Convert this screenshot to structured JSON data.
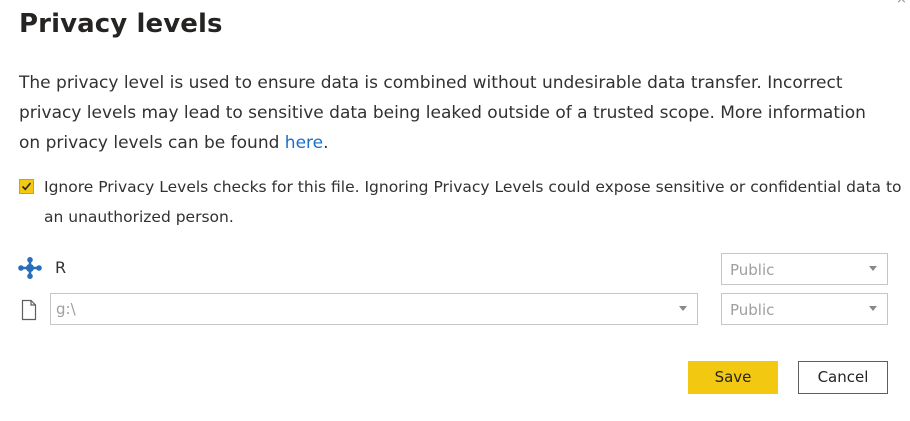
{
  "dialog": {
    "title": "Privacy levels",
    "description": "The privacy level is used to ensure data is combined without undesirable data transfer. Incorrect privacy levels may lead to sensitive data being leaked outside of a trusted scope. More information on privacy levels can be found ",
    "description_link": "here",
    "description_end": ".",
    "ignore_checkbox": {
      "checked": true,
      "label": "Ignore Privacy Levels checks for this file. Ignoring Privacy Levels could expose sensitive or confidential data to an unauthorized person."
    },
    "sources": [
      {
        "icon": "r-source-icon",
        "label": "R",
        "privacy_level": "Public"
      },
      {
        "icon": "file-icon",
        "path_value": "g:\\",
        "privacy_level": "Public"
      }
    ],
    "buttons": {
      "save": "Save",
      "cancel": "Cancel"
    }
  },
  "colors": {
    "accent": "#f2c811",
    "link": "#1a6fc9",
    "disabled_text": "#a19f9d"
  }
}
